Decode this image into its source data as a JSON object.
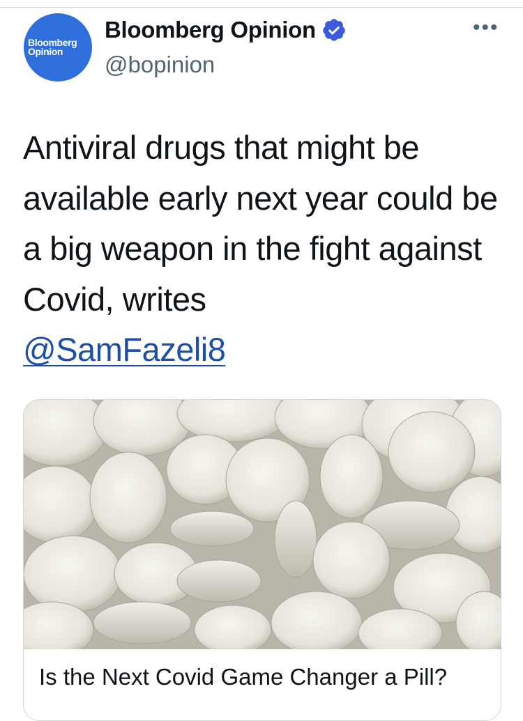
{
  "author": {
    "display_name": "Bloomberg Opinion",
    "handle": "@bopinion",
    "avatar_text_line1": "Bloomberg",
    "avatar_text_line2": "Opinion",
    "verified": true,
    "verified_color": "#3b5bdb"
  },
  "more_icon": "more-options-icon",
  "tweet": {
    "text": "Antiviral drugs that might be available early next year could be a big weapon in the fight against Covid, writes",
    "mention": "@SamFazeli8"
  },
  "card": {
    "image_description_icon": "white-pills-image",
    "title": "Is the Next Covid Game Changer a Pill?"
  },
  "colors": {
    "link": "#1d4ea8",
    "avatar_bg": "#2f6fdc"
  }
}
